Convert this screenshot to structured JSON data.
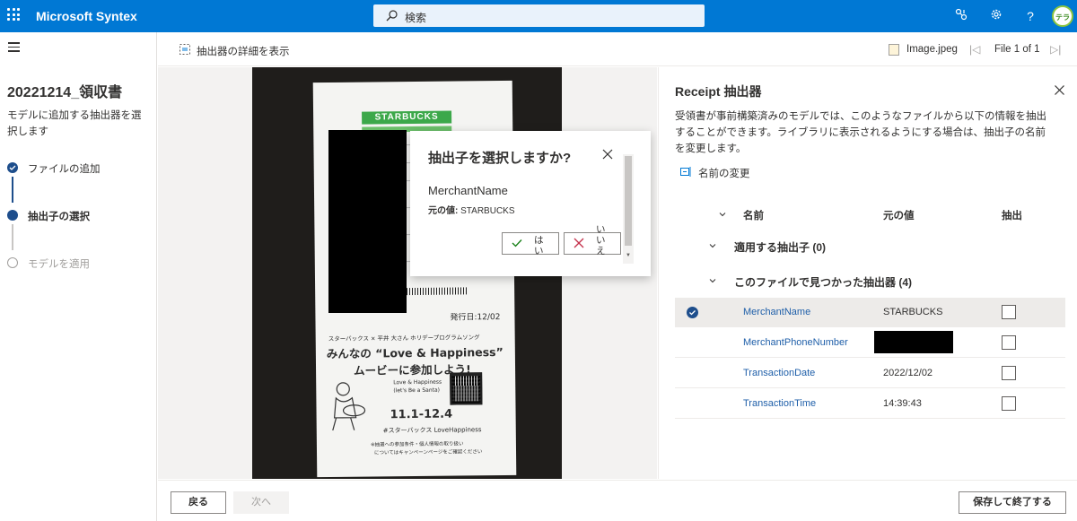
{
  "app": {
    "title": "Microsoft Syntex",
    "search_placeholder": "検索",
    "avatar_initials": "テラボ"
  },
  "left_panel": {
    "title": "20221214_領収書",
    "description": "モデルに追加する抽出器を選択します",
    "steps": [
      {
        "label": "ファイルの追加",
        "state": "done"
      },
      {
        "label": "抽出子の選択",
        "state": "current"
      },
      {
        "label": "モデルを適用",
        "state": "pending"
      }
    ]
  },
  "command_bar": {
    "show_details": "抽出器の詳細を表示",
    "file_name": "Image.jpeg",
    "file_count": "File 1 of 1"
  },
  "receipt_image": {
    "brand": "STARBUCKS",
    "issue_date": "発行日:12/02",
    "line1": "スターバックス × 平井 大さん ホリデープログラムソング",
    "headline1": "みんなの “Love & Happiness”",
    "headline2": "ムービーに参加しよう!",
    "song": "Love & Happiness",
    "song_sub": "(let's Be a Santa)",
    "dates": "11.1-12.4",
    "hashtag": "#スターバックス LoveHappiness",
    "note1": "※抽選への参加条件・個人情報の取り扱い",
    "note2": "についてはキャンペーンページをご確認ください"
  },
  "popup": {
    "title": "抽出子を選択しますか?",
    "field_name": "MerchantName",
    "original_label": "元の値:",
    "original_value": "STARBUCKS",
    "yes_label": "はい",
    "no_label": "いいえ"
  },
  "right_panel": {
    "title": "Receipt 抽出器",
    "description": "受領書が事前構築済みのモデルでは、このようなファイルから以下の情報を抽出することができます。ライブラリに表示されるようにする場合は、抽出子の名前を変更します。",
    "rename_label": "名前の変更",
    "columns": {
      "name": "名前",
      "original": "元の値",
      "extract": "抽出"
    },
    "group_applied": "適用する抽出子 (0)",
    "group_found": "このファイルで見つかった抽出器 (4)",
    "rows": [
      {
        "name": "MerchantName",
        "value": "STARBUCKS",
        "selected": true,
        "redacted": false
      },
      {
        "name": "MerchantPhoneNumber",
        "value": "",
        "selected": false,
        "redacted": true
      },
      {
        "name": "TransactionDate",
        "value": "2022/12/02",
        "selected": false,
        "redacted": false
      },
      {
        "name": "TransactionTime",
        "value": "14:39:43",
        "selected": false,
        "redacted": false
      }
    ]
  },
  "footer": {
    "back_label": "戻る",
    "next_label": "次へ",
    "save_exit_label": "保存して終了する"
  },
  "colors": {
    "brand_blue": "#0078d4",
    "step_done": "#1e4e8c",
    "link_blue": "#1f5fa9",
    "starbucks_green": "#3ca84a"
  }
}
